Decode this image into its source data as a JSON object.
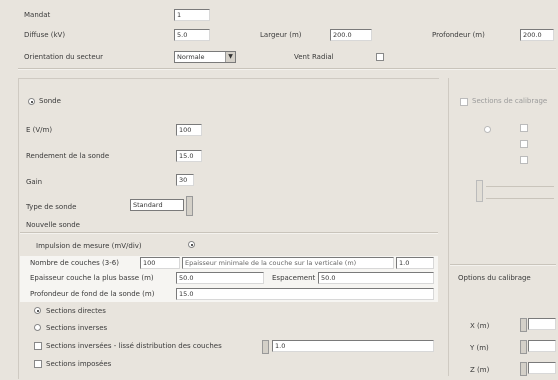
{
  "top": {
    "r1_label": "Mandat",
    "r1_value": "1",
    "r2_label": "Diffuse (kV)",
    "r2_value": "5.0",
    "r2_mid_label": "Largeur (m)",
    "r2_mid_value": "200.0",
    "r2_right_label": "Profondeur (m)",
    "r2_right_value": "200.0",
    "r3_label": "Orientation du secteur",
    "r3_value": "Normale",
    "r3_mid_label": "Vent Radial",
    "r3_check": ""
  },
  "left": {
    "section_title": "Sonde",
    "f1_label": "E (V/m)",
    "f1_value": "100",
    "f2_label": "Rendement de la sonde",
    "f2_value": "15.0",
    "f3_label": "Gain",
    "f3_value": "30",
    "f4_label": "Type de sonde",
    "f4_value": "Standard",
    "f5_label": "Nouvelle sonde",
    "f6_label": "Impulsion de mesure (mV/div)",
    "table": [
      {
        "label": "Nombre de couches (3-6)",
        "value": "100",
        "mid_label": "Epaisseur minimale de la couche sur la verticale (m)",
        "mid_value": "1.0"
      },
      {
        "label": "Epaisseur couche la plus basse (m)",
        "value": "50.0",
        "mid_label": "Espacement (m)",
        "mid_value": "50.0"
      },
      {
        "label": "Profondeur de fond de la sonde (m)",
        "value": "15.0"
      }
    ],
    "opt1": "Sections directes",
    "opt2": "Sections inverses",
    "opt3": "Sections inversées - lissé distribution des couches",
    "opt3_value": "1.0",
    "opt4": "Sections imposées"
  },
  "right": {
    "top_label": "Sections de calibrage",
    "section2_title": "Options du calibrage",
    "g1": "X (m)",
    "g2": "Y (m)",
    "g3": "Z (m)"
  }
}
